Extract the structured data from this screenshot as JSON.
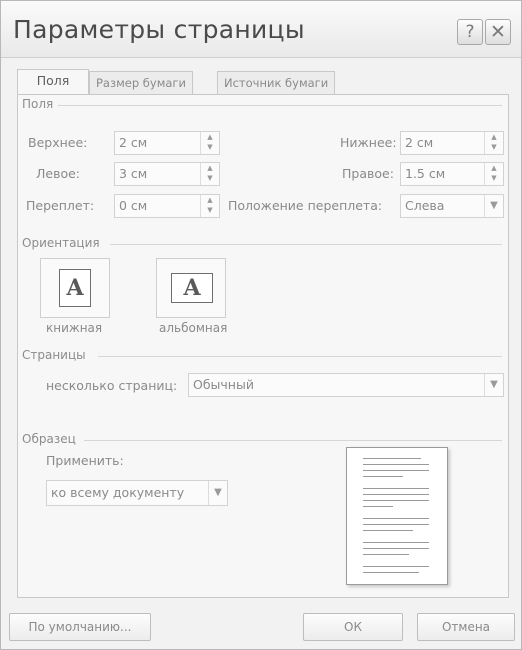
{
  "window": {
    "title": "Параметры страницы",
    "help_label": "?",
    "close_label": "✕"
  },
  "tabs": [
    {
      "label": "Поля",
      "active": true
    },
    {
      "label": "Размер бумаги",
      "active": false
    },
    {
      "label": "Источник бумаги",
      "active": false
    }
  ],
  "margins": {
    "group_label": "Поля",
    "top": {
      "label": "Верхнее:",
      "value": "2 см"
    },
    "bottom": {
      "label": "Нижнее:",
      "value": "2 см"
    },
    "left": {
      "label": "Левое:",
      "value": "3 см"
    },
    "right": {
      "label": "Правое:",
      "value": "1.5 см"
    },
    "gutter": {
      "label": "Переплет:",
      "value": "0 см"
    },
    "gutter_position": {
      "label": "Положение переплета:",
      "value": "Слева"
    }
  },
  "orientation": {
    "group_label": "Ориентация",
    "portrait": {
      "label": "книжная",
      "icon": "page-portrait-icon",
      "glyph": "A"
    },
    "landscape": {
      "label": "альбомная",
      "icon": "page-landscape-icon",
      "glyph": "A"
    }
  },
  "pages": {
    "group_label": "Страницы",
    "multiple_label": "несколько страниц:",
    "multiple_value": "Обычный"
  },
  "preview": {
    "group_label": "Образец",
    "apply_label": "Применить:",
    "apply_value": "ко всему документу"
  },
  "buttons": {
    "default": "По умолчанию...",
    "ok": "ОК",
    "cancel": "Отмена"
  }
}
